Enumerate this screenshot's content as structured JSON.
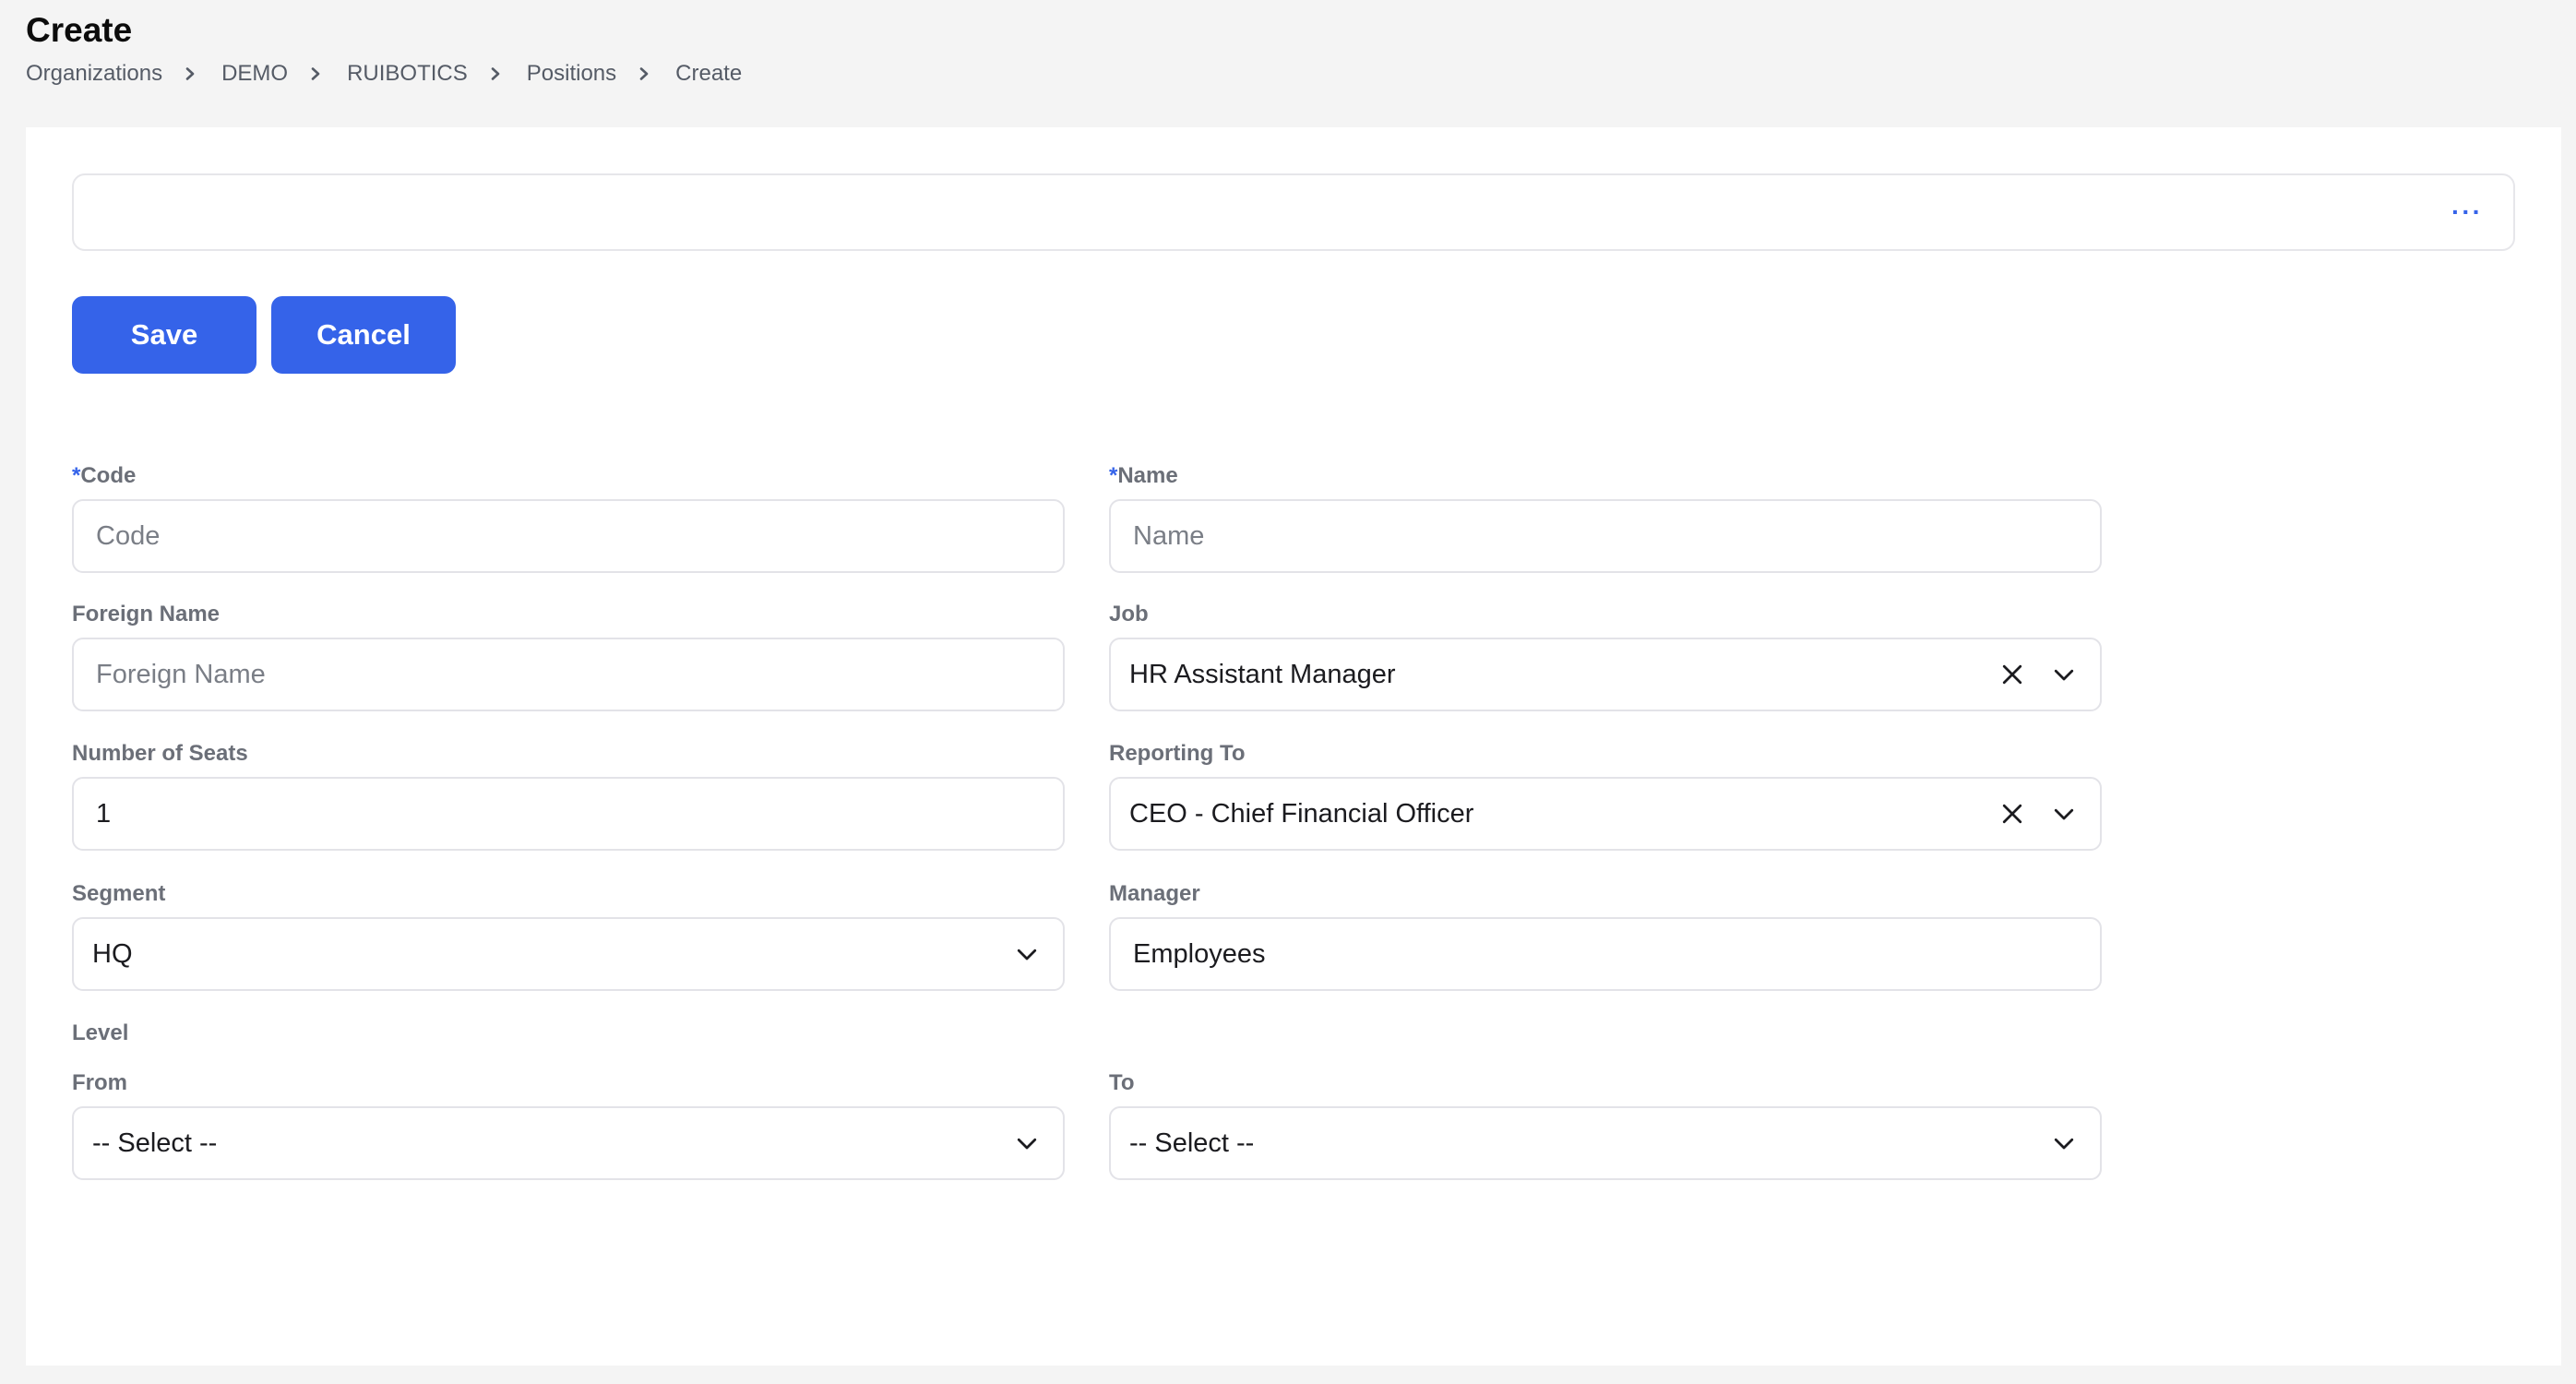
{
  "page": {
    "title": "Create",
    "breadcrumb": [
      "Organizations",
      "DEMO",
      "RUIBOTICS",
      "Positions",
      "Create"
    ]
  },
  "toolbar": {
    "more_label": "···",
    "save_label": "Save",
    "cancel_label": "Cancel"
  },
  "form": {
    "required_mark": "*",
    "code": {
      "label": "Code",
      "placeholder": "Code",
      "value": ""
    },
    "name": {
      "label": "Name",
      "placeholder": "Name",
      "value": ""
    },
    "foreign_name": {
      "label": "Foreign Name",
      "placeholder": "Foreign Name",
      "value": ""
    },
    "job": {
      "label": "Job",
      "value": "HR Assistant Manager"
    },
    "number_of_seats": {
      "label": "Number of Seats",
      "value": "1"
    },
    "reporting_to": {
      "label": "Reporting To",
      "value": "CEO - Chief Financial Officer"
    },
    "segment": {
      "label": "Segment",
      "value": "HQ"
    },
    "manager": {
      "label": "Manager",
      "value": "Employees"
    },
    "level": {
      "label": "Level",
      "from": {
        "label": "From",
        "value": "-- Select --"
      },
      "to": {
        "label": "To",
        "value": "-- Select --"
      }
    }
  },
  "colors": {
    "accent": "#3563e9",
    "border": "#e3e3e8",
    "label": "#6b6f78"
  }
}
